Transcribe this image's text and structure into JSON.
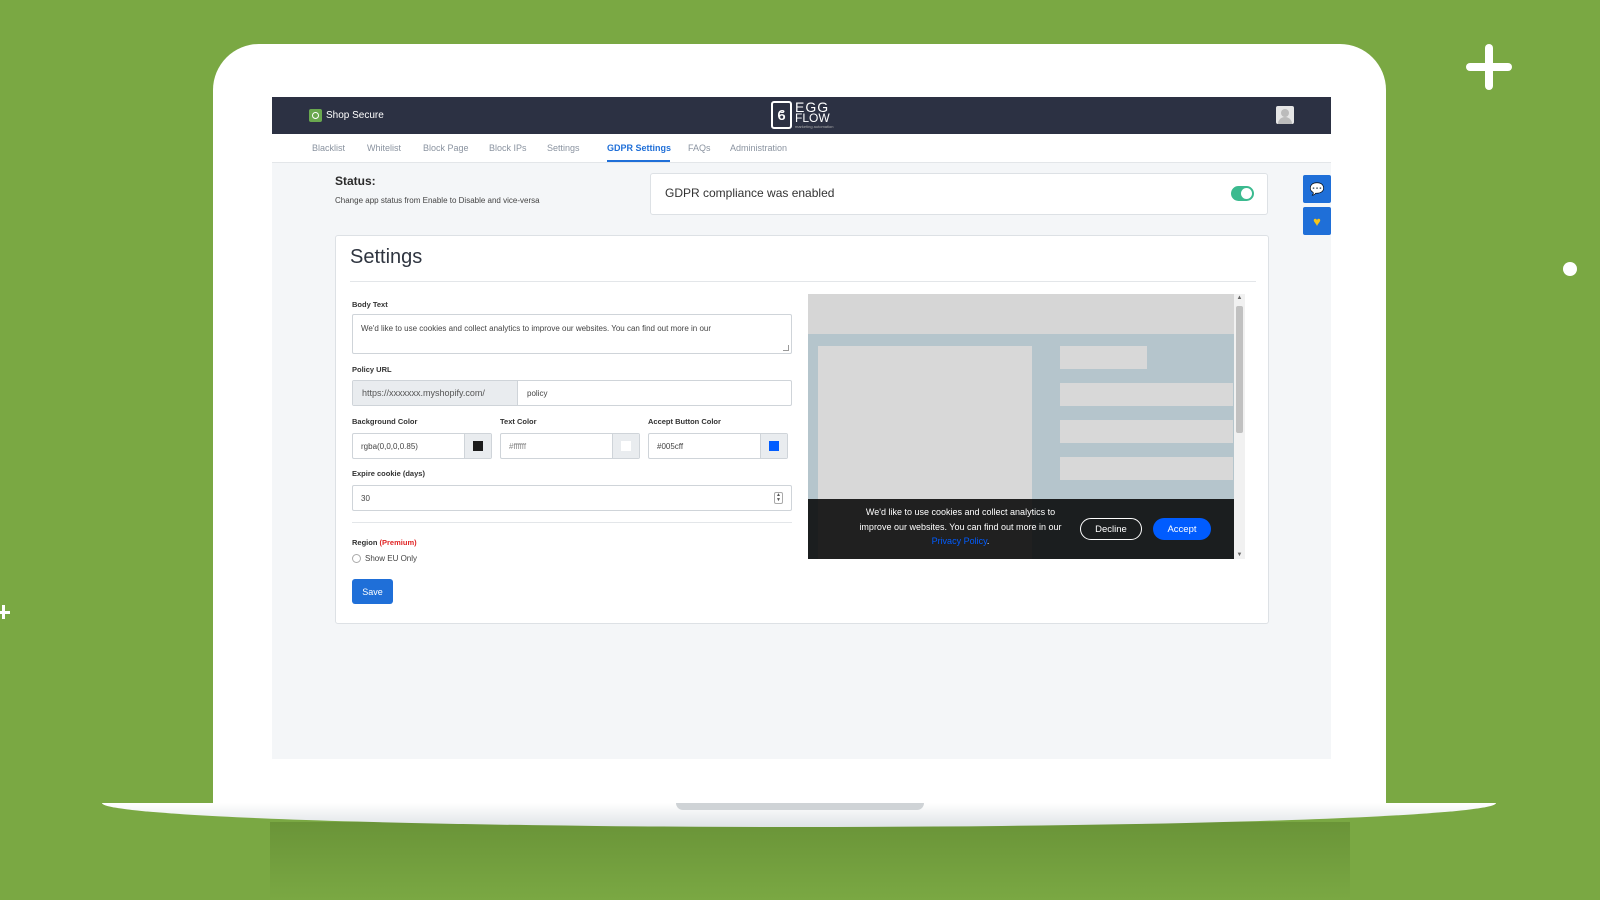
{
  "app": {
    "brand_name": "Shop Secure",
    "logo_line1": "EGG",
    "logo_line2": "FLOW",
    "logo_tagline": "marketing automation"
  },
  "nav": {
    "items": [
      {
        "label": "Blacklist"
      },
      {
        "label": "Whitelist"
      },
      {
        "label": "Block Page"
      },
      {
        "label": "Block IPs"
      },
      {
        "label": "Settings"
      },
      {
        "label": "GDPR Settings"
      },
      {
        "label": "FAQs"
      },
      {
        "label": "Administration"
      }
    ],
    "active": "GDPR Settings"
  },
  "status": {
    "title": "Status:",
    "description": "Change app status from Enable to Disable and vice-versa",
    "message": "GDPR compliance was enabled",
    "enabled": true
  },
  "settings": {
    "title": "Settings",
    "body_text_label": "Body Text",
    "body_text_value": "We'd like to use cookies and collect analytics to improve our websites. You can find out more in our",
    "policy_url_label": "Policy URL",
    "policy_url_prefix": "https://xxxxxxx.myshopify.com/",
    "policy_url_value": "policy",
    "bg_color_label": "Background Color",
    "bg_color_value": "rgba(0,0,0,0.85)",
    "text_color_label": "Text Color",
    "text_color_value": "#ffffff",
    "accept_color_label": "Accept Button Color",
    "accept_color_value": "#005cff",
    "expire_label": "Expire cookie (days)",
    "expire_value": "30",
    "region_label": "Region",
    "region_premium": "(Premium)",
    "show_eu_label": "Show EU Only",
    "save_label": "Save"
  },
  "preview": {
    "cookie_text_line1": "We'd like to use cookies and collect analytics to",
    "cookie_text_line2": "improve our websites. You can find out more in our",
    "policy_link": "Privacy Policy",
    "policy_suffix": ".",
    "decline_label": "Decline",
    "accept_label": "Accept"
  },
  "colors": {
    "page_background": "#7aa843",
    "topbar": "#2c3143",
    "accent": "#1f6fd8",
    "toggle_on": "#3bba8f",
    "accept_button": "#005cff"
  },
  "icons": {
    "chat": "chat-icon",
    "heart": "heart-icon",
    "user": "user-avatar-icon"
  }
}
